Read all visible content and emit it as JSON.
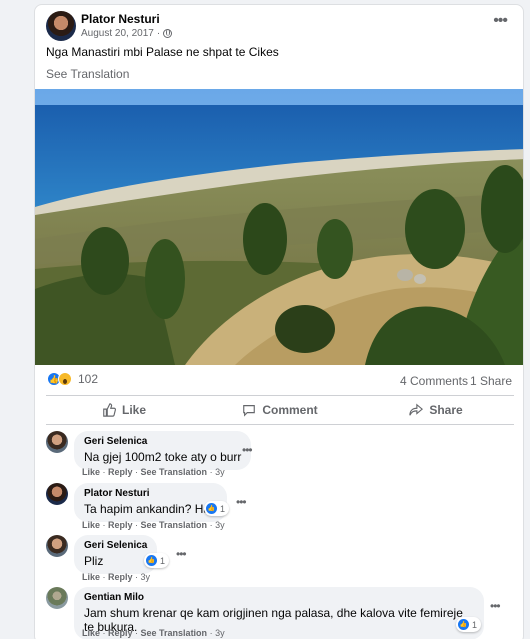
{
  "post": {
    "author": "Plator Nesturi",
    "date": "August 20, 2017",
    "separator": "·",
    "text": "Nga Manastiri mbi Palase ne shpat te Cikes",
    "see_translation": "See Translation",
    "reaction_count": "102",
    "comments_count": "4 Comments",
    "shares_count": "1 Share"
  },
  "actions": {
    "like": "Like",
    "comment": "Comment",
    "share": "Share"
  },
  "comments": [
    {
      "name": "Geri Selenica",
      "text": "Na gjej 100m2 toke aty o burr",
      "like": "Like",
      "reply": "Reply",
      "translation": "See Translation",
      "age": "3y"
    },
    {
      "name": "Plator Nesturi",
      "text": "Ta hapim ankandin? Hah",
      "like": "Like",
      "reply": "Reply",
      "translation": "See Translation",
      "age": "3y",
      "reacts": "1"
    },
    {
      "name": "Geri Selenica",
      "text": "Pliz",
      "like": "Like",
      "reply": "Reply",
      "age": "3y",
      "reacts": "1"
    },
    {
      "name": "Gentian Milo",
      "text": "Jam shum krenar qe kam origjinen nga palasa, dhe kalova vite femireje te bukura.",
      "like": "Like",
      "reply": "Reply",
      "translation": "See Translation",
      "age": "3y",
      "reacts": "1"
    }
  ],
  "colors": {
    "like_blue": "#1877f2",
    "wow_yellow": "#f7b928",
    "muted_text": "#65676b"
  }
}
